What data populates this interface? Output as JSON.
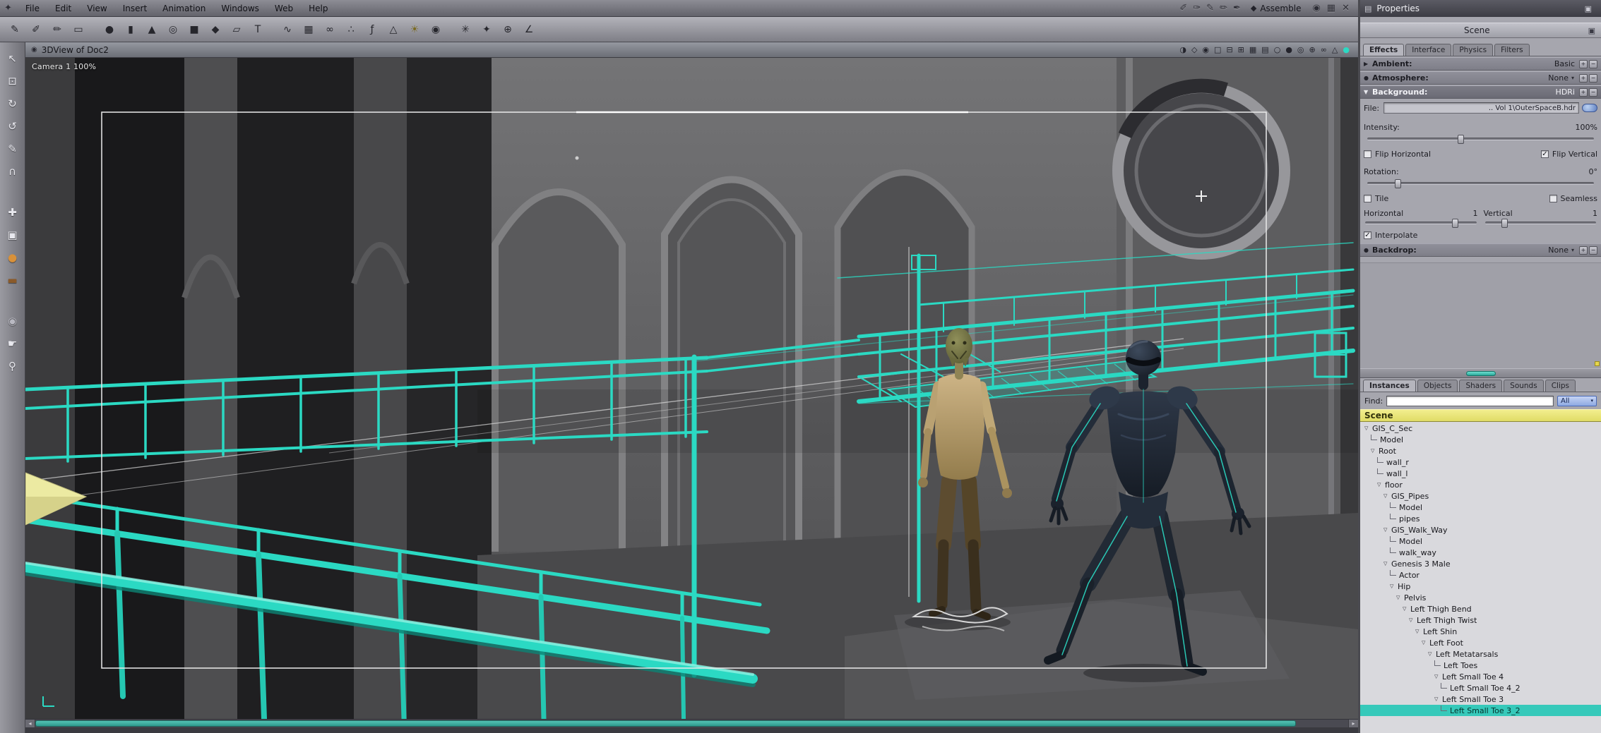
{
  "icons": {
    "plus": "+",
    "minus": "−",
    "dropdown": "▾",
    "expand_open": "▼",
    "expand_closed": "▶",
    "bullet": "●",
    "check": "✓",
    "tree_branch": "▽",
    "doc": "◉",
    "scroll_left": "◂",
    "scroll_right": "▸",
    "panel_menu": "▤",
    "panel_detach": "▣",
    "scene_options": "▣"
  },
  "menubar": {
    "items": [
      "File",
      "Edit",
      "View",
      "Insert",
      "Animation",
      "Windows",
      "Web",
      "Help"
    ],
    "tool_icons": [
      {
        "name": "hand-tool-icon",
        "glyph": "✐"
      },
      {
        "name": "stamp-tool-icon",
        "glyph": "✑"
      },
      {
        "name": "pen-tool-icon",
        "glyph": "✎"
      },
      {
        "name": "knife-tool-icon",
        "glyph": "✏"
      },
      {
        "name": "brush-tool-icon",
        "glyph": "✒"
      }
    ],
    "mode_icon": "◆",
    "mode_label": "Assemble",
    "window_icons": [
      {
        "name": "visibility-eye-icon",
        "glyph": "◉"
      },
      {
        "name": "grid-toggle-icon",
        "glyph": "▦"
      },
      {
        "name": "close-icon",
        "glyph": "✕"
      }
    ]
  },
  "toolbar": {
    "icons": [
      {
        "name": "edit-tool-icon",
        "glyph": "✎"
      },
      {
        "name": "paint-finger-icon",
        "glyph": "✐"
      },
      {
        "name": "ink-tool-icon",
        "glyph": "✏"
      },
      {
        "name": "eraser-tool-icon",
        "glyph": "▭"
      },
      {
        "name": "sphere-primitive-icon",
        "glyph": "●"
      },
      {
        "name": "cylinder-primitive-icon",
        "glyph": "▮"
      },
      {
        "name": "cone-primitive-icon",
        "glyph": "▲"
      },
      {
        "name": "torus-primitive-icon",
        "glyph": "◎"
      },
      {
        "name": "cube-primitive-icon",
        "glyph": "■"
      },
      {
        "name": "icosahedron-primitive-icon",
        "glyph": "◆"
      },
      {
        "name": "plane-primitive-icon",
        "glyph": "▱"
      },
      {
        "name": "text-primitive-icon",
        "glyph": "T"
      },
      {
        "name": "spline-tool-icon",
        "glyph": "∿"
      },
      {
        "name": "vertex-mesh-icon",
        "glyph": "▦"
      },
      {
        "name": "metaball-tool-icon",
        "glyph": "∞"
      },
      {
        "name": "particle-tool-icon",
        "glyph": "∴"
      },
      {
        "name": "formula-tool-icon",
        "glyph": "ƒ"
      },
      {
        "name": "terrain-tool-icon",
        "glyph": "△"
      },
      {
        "name": "light-tool-icon",
        "glyph": "☀",
        "color": "#7a6a20"
      },
      {
        "name": "camera-tool-icon",
        "glyph": "◉"
      },
      {
        "name": "spray-tool-icon",
        "glyph": "✳"
      },
      {
        "name": "wizard-tool-icon",
        "glyph": "✦"
      },
      {
        "name": "target-tool-icon",
        "glyph": "⊕"
      },
      {
        "name": "measure-tool-icon",
        "glyph": "∠"
      }
    ]
  },
  "left_toolbar": {
    "icons": [
      {
        "name": "pointer-tool-icon",
        "glyph": "↖"
      },
      {
        "name": "marquee-tool-icon",
        "glyph": "⊡"
      },
      {
        "name": "rotate-tool-icon",
        "glyph": "↻"
      },
      {
        "name": "orbit-tool-icon",
        "glyph": "↺"
      },
      {
        "name": "draw-tool-icon",
        "glyph": "✎"
      },
      {
        "name": "magnet-tool-icon",
        "glyph": "∩"
      },
      {
        "name": "move-tool-icon",
        "glyph": "✚"
      },
      {
        "name": "scale-tool-icon",
        "glyph": "▣"
      },
      {
        "name": "rotate-ball-tool-icon",
        "glyph": "●",
        "color": "#d8913a"
      },
      {
        "name": "paint-roller-tool-icon",
        "glyph": "▬",
        "color": "#8a5a2a"
      },
      {
        "name": "camera-move-tool-icon",
        "glyph": "◉",
        "color": "#b9b9c2"
      },
      {
        "name": "pan-hand-tool-icon",
        "glyph": "☛"
      },
      {
        "name": "zoom-tool-icon",
        "glyph": "⚲"
      }
    ]
  },
  "viewport": {
    "title": "3DView of Doc2",
    "camera_label": "Camera 1 100%",
    "header_icons": [
      {
        "name": "preview-quality-icon",
        "glyph": "◑"
      },
      {
        "name": "wireframe-mode-icon",
        "glyph": "◇"
      },
      {
        "name": "camera-view-icon",
        "glyph": "◉"
      },
      {
        "name": "layout-single-icon",
        "glyph": "□"
      },
      {
        "name": "layout-2pane-icon",
        "glyph": "⊟"
      },
      {
        "name": "layout-3pane-icon",
        "glyph": "⊞"
      },
      {
        "name": "layout-4pane-icon",
        "glyph": "▦"
      },
      {
        "name": "layout-wide-icon",
        "glyph": "▤"
      },
      {
        "name": "globe-light-icon",
        "glyph": "○"
      },
      {
        "name": "globe-dark-icon",
        "glyph": "●"
      },
      {
        "name": "globe-wire-icon",
        "glyph": "◎"
      },
      {
        "name": "axis-lock-icon",
        "glyph": "⊕"
      },
      {
        "name": "link-icon",
        "glyph": "∞"
      },
      {
        "name": "production-frame-icon",
        "glyph": "△"
      },
      {
        "name": "sync-indicator-icon",
        "glyph": "●",
        "color": "#2bd9c3"
      }
    ]
  },
  "properties": {
    "title": "Properties",
    "scene_label": "Scene",
    "tabs": [
      "Effects",
      "Interface",
      "Physics",
      "Filters"
    ],
    "active_tab": "Effects",
    "ambient": {
      "label": "Ambient:",
      "value": "Basic"
    },
    "atmosphere": {
      "label": "Atmosphere:",
      "value": "None"
    },
    "background": {
      "label": "Background:",
      "value": "HDRi"
    },
    "file": {
      "label": "File:",
      "value": ".. Vol 1\\OuterSpaceB.hdr"
    },
    "intensity": {
      "label": "Intensity:",
      "value": "100%"
    },
    "flip_horizontal": {
      "label": "Flip Horizontal",
      "checked": false
    },
    "flip_vertical": {
      "label": "Flip Vertical",
      "checked": true
    },
    "rotation": {
      "label": "Rotation:",
      "value": "0°"
    },
    "tile": {
      "label": "Tile",
      "checked": false
    },
    "seamless": {
      "label": "Seamless",
      "checked": false
    },
    "horizontal": {
      "label": "Horizontal",
      "value": "1"
    },
    "vertical": {
      "label": "Vertical",
      "value": "1"
    },
    "interpolate": {
      "label": "Interpolate",
      "checked": true
    },
    "backdrop": {
      "label": "Backdrop:",
      "value": "None"
    }
  },
  "browser": {
    "tabs": [
      "Instances",
      "Objects",
      "Shaders",
      "Sounds",
      "Clips"
    ],
    "active_tab": "Instances",
    "find_label": "Find:",
    "find_value": "",
    "filter_value": "All",
    "scene_header": "Scene",
    "tree": [
      {
        "label": "GIS_C_Sec",
        "level": 0,
        "branch": true
      },
      {
        "label": "Model",
        "level": 1,
        "branch": false
      },
      {
        "label": "Root",
        "level": 1,
        "branch": true
      },
      {
        "label": "wall_r",
        "level": 2,
        "branch": false
      },
      {
        "label": "wall_l",
        "level": 2,
        "branch": false
      },
      {
        "label": "floor",
        "level": 2,
        "branch": true
      },
      {
        "label": "GIS_Pipes",
        "level": 3,
        "branch": true
      },
      {
        "label": "Model",
        "level": 4,
        "branch": false
      },
      {
        "label": "pipes",
        "level": 4,
        "branch": false
      },
      {
        "label": "GIS_Walk_Way",
        "level": 3,
        "branch": true
      },
      {
        "label": "Model",
        "level": 4,
        "branch": false
      },
      {
        "label": "walk_way",
        "level": 4,
        "branch": false
      },
      {
        "label": "Genesis 3 Male",
        "level": 3,
        "branch": true
      },
      {
        "label": "Actor",
        "level": 4,
        "branch": false
      },
      {
        "label": "Hip",
        "level": 4,
        "branch": true
      },
      {
        "label": "Pelvis",
        "level": 5,
        "branch": true
      },
      {
        "label": "Left Thigh Bend",
        "level": 6,
        "branch": true
      },
      {
        "label": "Left Thigh Twist",
        "level": 7,
        "branch": true
      },
      {
        "label": "Left Shin",
        "level": 8,
        "branch": true
      },
      {
        "label": "Left Foot",
        "level": 9,
        "branch": true
      },
      {
        "label": "Left Metatarsals",
        "level": 10,
        "branch": true
      },
      {
        "label": "Left Toes",
        "level": 11,
        "branch": false
      },
      {
        "label": "Left Small Toe 4",
        "level": 11,
        "branch": true
      },
      {
        "label": "Left Small Toe 4_2",
        "level": 12,
        "branch": false
      },
      {
        "label": "Left Small Toe 3",
        "level": 11,
        "branch": true
      },
      {
        "label": "Left Small Toe 3_2",
        "level": 12,
        "branch": false,
        "selected": true
      }
    ]
  },
  "colors": {
    "accent_teal": "#2bd9c3",
    "selection_teal": "#36c9ba",
    "scene_header_yellow": "#eeea7e"
  }
}
